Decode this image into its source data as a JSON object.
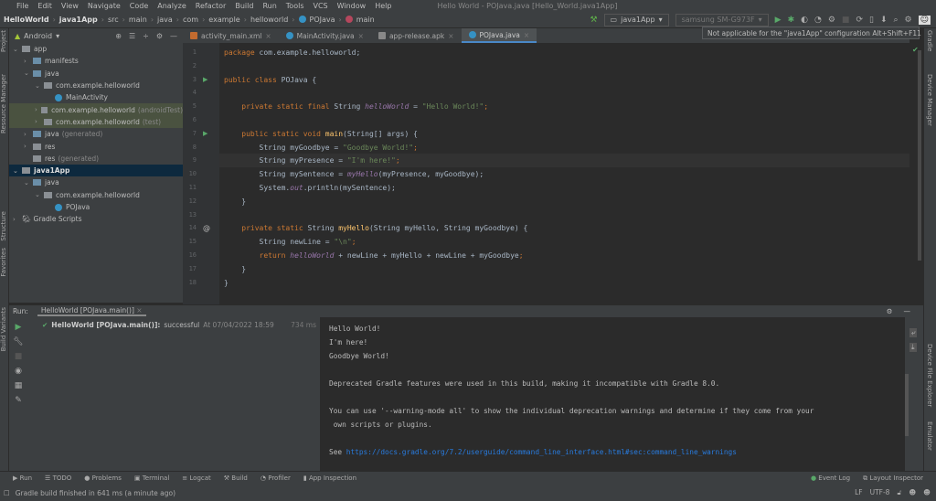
{
  "menu": [
    "File",
    "Edit",
    "View",
    "Navigate",
    "Code",
    "Analyze",
    "Refactor",
    "Build",
    "Run",
    "Tools",
    "VCS",
    "Window",
    "Help"
  ],
  "window_title": "Hello World - POJava.java [Hello_World.java1App]",
  "breadcrumb": [
    "HelloWorld",
    "java1App",
    "src",
    "main",
    "java",
    "com",
    "example",
    "helloworld",
    "POJava",
    "main"
  ],
  "toolbar": {
    "config": "java1App",
    "device": "samsung SM-G973F"
  },
  "tooltip": "Not applicable for the \"java1App\" configuration  Alt+Shift+F11",
  "project": {
    "view": "Android",
    "tree": [
      {
        "label": "app",
        "extra": "",
        "depth": 0,
        "arrow": "v",
        "type": "module",
        "state": ""
      },
      {
        "label": "manifests",
        "extra": "",
        "depth": 1,
        "arrow": ">",
        "type": "folder",
        "state": ""
      },
      {
        "label": "java",
        "extra": "",
        "depth": 1,
        "arrow": "v",
        "type": "folder",
        "state": ""
      },
      {
        "label": "com.example.helloworld",
        "extra": "",
        "depth": 2,
        "arrow": "v",
        "type": "pkg",
        "state": ""
      },
      {
        "label": "MainActivity",
        "extra": "",
        "depth": 3,
        "arrow": "",
        "type": "class",
        "state": ""
      },
      {
        "label": "com.example.helloworld",
        "extra": "(androidTest)",
        "depth": 2,
        "arrow": ">",
        "type": "pkg",
        "state": "hl"
      },
      {
        "label": "com.example.helloworld",
        "extra": "(test)",
        "depth": 2,
        "arrow": ">",
        "type": "pkg",
        "state": "hl"
      },
      {
        "label": "java",
        "extra": "(generated)",
        "depth": 1,
        "arrow": ">",
        "type": "folder",
        "state": ""
      },
      {
        "label": "res",
        "extra": "",
        "depth": 1,
        "arrow": ">",
        "type": "pkg",
        "state": ""
      },
      {
        "label": "res",
        "extra": "(generated)",
        "depth": 1,
        "arrow": "",
        "type": "pkg",
        "state": ""
      },
      {
        "label": "java1App",
        "extra": "",
        "depth": 0,
        "arrow": "v",
        "type": "module",
        "state": "sel"
      },
      {
        "label": "java",
        "extra": "",
        "depth": 1,
        "arrow": "v",
        "type": "folder",
        "state": ""
      },
      {
        "label": "com.example.helloworld",
        "extra": "",
        "depth": 2,
        "arrow": "v",
        "type": "pkg",
        "state": ""
      },
      {
        "label": "POJava",
        "extra": "",
        "depth": 3,
        "arrow": "",
        "type": "class",
        "state": ""
      },
      {
        "label": "Gradle Scripts",
        "extra": "",
        "depth": 0,
        "arrow": ">",
        "type": "gradle",
        "state": ""
      }
    ]
  },
  "tabs": [
    {
      "label": "activity_main.xml",
      "active": false
    },
    {
      "label": "MainActivity.java",
      "active": false
    },
    {
      "label": "app-release.apk",
      "active": false
    },
    {
      "label": "POJava.java",
      "active": true
    }
  ],
  "code": [
    [
      [
        "package ",
        "kw"
      ],
      [
        "com.example.helloworld;",
        "pl"
      ]
    ],
    [],
    [
      [
        "public class ",
        "kw"
      ],
      [
        "POJava {",
        "pl"
      ]
    ],
    [],
    [
      [
        "    private static final ",
        "kw"
      ],
      [
        "String ",
        "pl"
      ],
      [
        "helloWorld",
        "fld"
      ],
      [
        " = ",
        "pl"
      ],
      [
        "\"Hello World!\"",
        "str"
      ],
      [
        ";",
        "kw"
      ]
    ],
    [],
    [
      [
        "    public static void ",
        "kw"
      ],
      [
        "main",
        "fn"
      ],
      [
        "(String[] args) {",
        "pl"
      ]
    ],
    [
      [
        "        String myGoodbye = ",
        "pl"
      ],
      [
        "\"Goodbye World!\"",
        "str"
      ],
      [
        ";",
        "kw"
      ]
    ],
    [
      [
        "        String myPresence = ",
        "pl"
      ],
      [
        "\"I'm here!\"",
        "str"
      ],
      [
        ";",
        "kw"
      ]
    ],
    [
      [
        "        String mySentence = ",
        "pl"
      ],
      [
        "myHello",
        "st"
      ],
      [
        "(myPresence, myGoodbye);",
        "pl"
      ]
    ],
    [
      [
        "        System.",
        "pl"
      ],
      [
        "out",
        "fld"
      ],
      [
        ".println(mySentence);",
        "pl"
      ]
    ],
    [
      [
        "    }",
        "pl"
      ]
    ],
    [],
    [
      [
        "    private static ",
        "kw"
      ],
      [
        "String ",
        "pl"
      ],
      [
        "myHello",
        "fn"
      ],
      [
        "(String myHello, String myGoodbye) {",
        "pl"
      ]
    ],
    [
      [
        "        String newLine = ",
        "pl"
      ],
      [
        "\"\\n\"",
        "str"
      ],
      [
        ";",
        "kw"
      ]
    ],
    [
      [
        "        return ",
        "kw"
      ],
      [
        "helloWorld",
        "fld"
      ],
      [
        " + newLine + myHello + newLine + myGoodbye",
        "pl"
      ],
      [
        ";",
        "kw"
      ]
    ],
    [
      [
        "    }",
        "pl"
      ]
    ],
    [
      [
        "}",
        "pl"
      ]
    ]
  ],
  "run": {
    "label": "Run:",
    "tab": "HelloWorld [POJava.main()]",
    "result_bold": "HelloWorld [POJava.main()]:",
    "result": "successful",
    "time": "At 07/04/2022 18:59",
    "duration": "734 ms",
    "console": [
      "Hello World!",
      "I'm here!",
      "Goodbye World!",
      "",
      "Deprecated Gradle features were used in this build, making it incompatible with Gradle 8.0.",
      "",
      "You can use '--warning-mode all' to show the individual deprecation warnings and determine if they come from your",
      " own scripts or plugins.",
      ""
    ],
    "see": "See ",
    "link": "https://docs.gradle.org/7.2/userguide/command_line_interface.html#sec:command_line_warnings"
  },
  "left_strip": [
    "Project",
    "Resource Manager",
    "Structure",
    "Favorites",
    "Build Variants"
  ],
  "right_strip": [
    "Gradle",
    "Device Manager",
    "Device File Explorer",
    "Emulator"
  ],
  "bottom_tools": [
    "Run",
    "TODO",
    "Problems",
    "Terminal",
    "Logcat",
    "Build",
    "Profiler",
    "App Inspection"
  ],
  "bottom_right": [
    "Event Log",
    "Layout Inspector"
  ],
  "status": {
    "message": "Gradle build finished in 641 ms (a minute ago)",
    "line_sep": "LF",
    "encoding": "UTF-8"
  }
}
